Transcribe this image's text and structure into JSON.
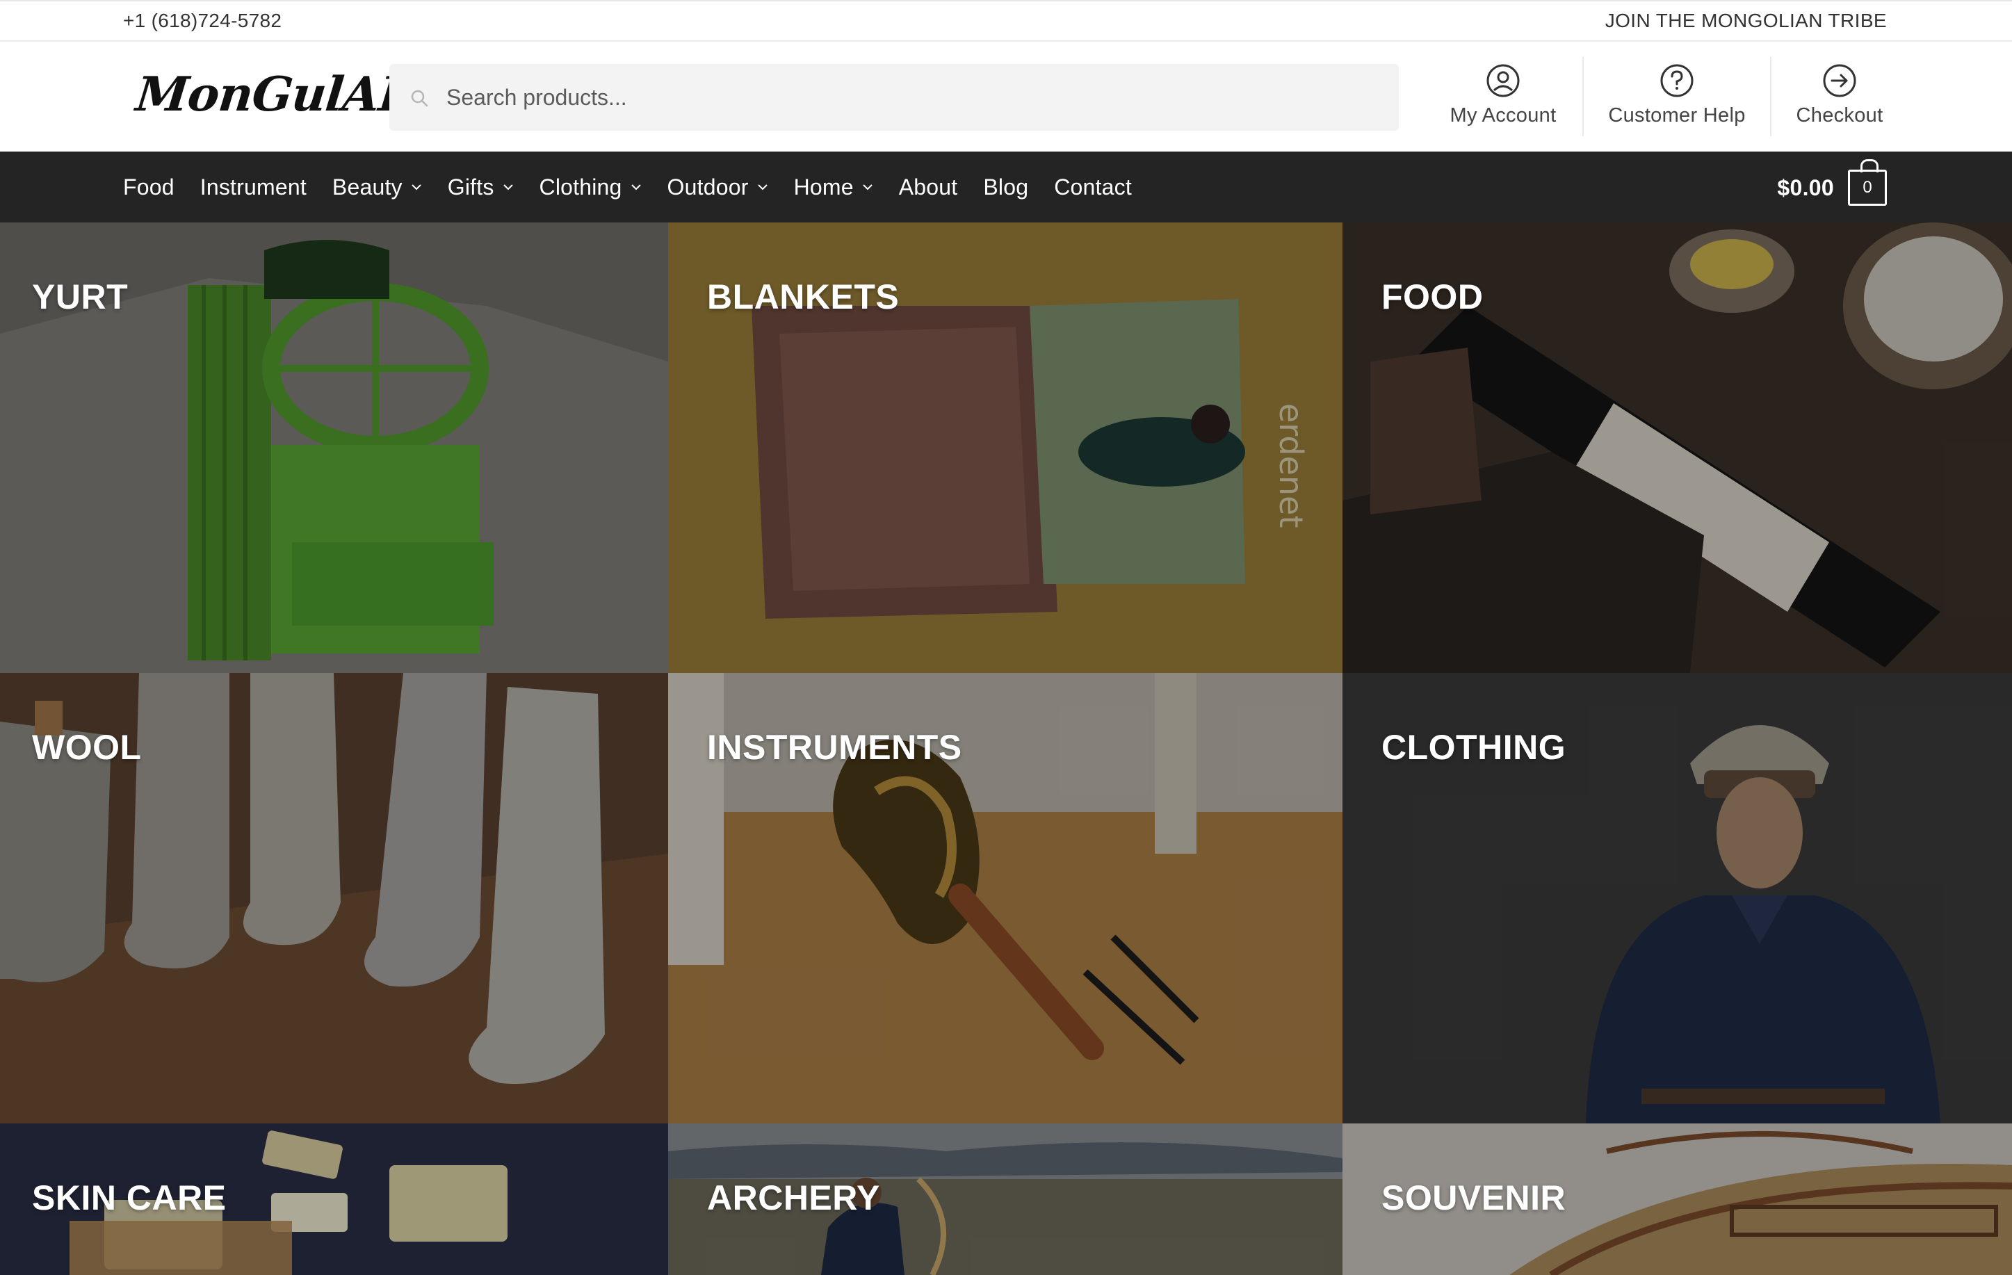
{
  "topbar": {
    "phone": "+1 (618)724-5782",
    "tribe_link": "JOIN THE MONGOLIAN TRIBE"
  },
  "header": {
    "logo_text": "MonGulAI",
    "search_placeholder": "Search products...",
    "links": [
      {
        "label": "My Account",
        "icon": "user-circle-icon"
      },
      {
        "label": "Customer Help",
        "icon": "question-circle-icon"
      },
      {
        "label": "Checkout",
        "icon": "arrow-circle-right-icon"
      }
    ]
  },
  "nav": {
    "items": [
      {
        "label": "Food",
        "dropdown": false
      },
      {
        "label": "Instrument",
        "dropdown": false
      },
      {
        "label": "Beauty",
        "dropdown": true
      },
      {
        "label": "Gifts",
        "dropdown": true
      },
      {
        "label": "Clothing",
        "dropdown": true
      },
      {
        "label": "Outdoor",
        "dropdown": true
      },
      {
        "label": "Home",
        "dropdown": true
      },
      {
        "label": "About",
        "dropdown": false
      },
      {
        "label": "Blog",
        "dropdown": false
      },
      {
        "label": "Contact",
        "dropdown": false
      }
    ],
    "cart_total": "$0.00",
    "cart_count": "0"
  },
  "categories": [
    {
      "label": "YURT"
    },
    {
      "label": "BLANKETS"
    },
    {
      "label": "FOOD"
    },
    {
      "label": "WOOL"
    },
    {
      "label": "INSTRUMENTS"
    },
    {
      "label": "CLOTHING"
    },
    {
      "label": "SKIN CARE"
    },
    {
      "label": "ARCHERY"
    },
    {
      "label": "SOUVENIR"
    }
  ],
  "colors": {
    "nav_bg": "#242424",
    "text_dark": "#333333",
    "search_bg": "#f3f3f3"
  }
}
